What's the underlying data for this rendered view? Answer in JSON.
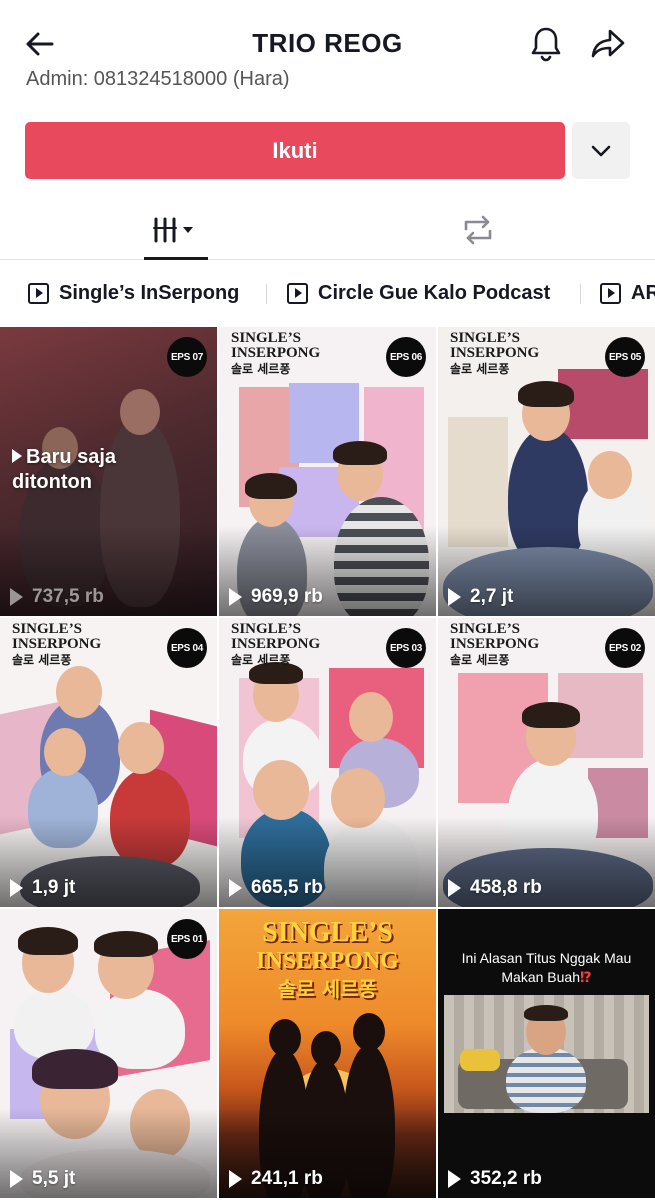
{
  "header": {
    "title": "TRIO REOG",
    "bio_clipped": "Admin: 081324518000 (Hara)"
  },
  "actions": {
    "follow_label": "Ikuti"
  },
  "icons": {
    "back": "arrow-left-icon",
    "notifications": "bell-icon",
    "share": "share-arrow-icon",
    "more": "chevron-down-icon",
    "videos_tab": "grid-bars-icon",
    "repost_tab": "repost-icon",
    "playlist": "play-square-icon"
  },
  "colors": {
    "follow_button": "#e8495d",
    "text": "#161823",
    "secondary_button": "#f1f1f2"
  },
  "playlists": [
    {
      "label": "Single’s InSerpong"
    },
    {
      "label": "Circle Gue Kalo Podcast"
    },
    {
      "label": "AR"
    }
  ],
  "videos": [
    {
      "views": "737,5 rb",
      "eps": "EPS 07",
      "status": "Baru saja",
      "status2": "ditonton"
    },
    {
      "views": "969,9 rb",
      "eps": "EPS 06",
      "logo_line1": "SINGLE’S",
      "logo_line2": "INSERPONG",
      "logo_line3": "솔로 세르퐁"
    },
    {
      "views": "2,7 jt",
      "eps": "EPS 05",
      "logo_line1": "SINGLE’S",
      "logo_line2": "INSERPONG",
      "logo_line3": "솔로 세르퐁"
    },
    {
      "views": "1,9 jt",
      "eps": "EPS 04",
      "logo_line1": "SINGLE’S",
      "logo_line2": "INSERPONG",
      "logo_line3": "솔로 세르퐁"
    },
    {
      "views": "665,5 rb",
      "eps": "EPS 03",
      "logo_line1": "SINGLE’S",
      "logo_line2": "INSERPONG",
      "logo_line3": "솔로 세르퐁"
    },
    {
      "views": "458,8 rb",
      "eps": "EPS 02",
      "logo_line1": "SINGLE’S",
      "logo_line2": "INSERPONG",
      "logo_line3": "솔로 세르퐁"
    },
    {
      "views": "5,5 jt",
      "eps": "EPS 01"
    },
    {
      "views": "241,1 rb",
      "poster_line1": "SINGLE’S",
      "poster_line2": "INSERPONG",
      "poster_line3": "솔로 세르퐁"
    },
    {
      "views": "352,2 rb",
      "caption": "Ini Alasan Titus Nggak Mau Makan Buah",
      "caption_mark": "⁉"
    }
  ]
}
